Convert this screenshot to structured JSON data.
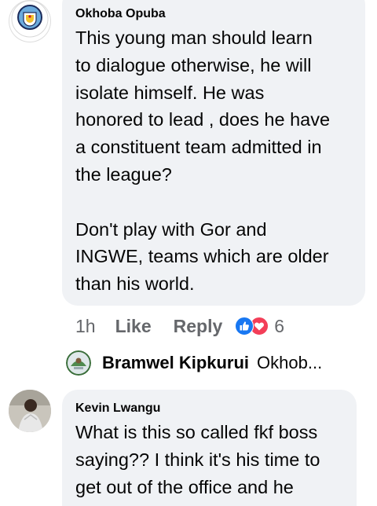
{
  "comments": [
    {
      "author": "Okhoba Opuba",
      "text": "This young man should learn\nto dialogue otherwise, he will\nisolate himself. He was\nhonored to lead , does he have\na constituent team admitted in\nthe league?\n\nDon't play with Gor and\nINGWE, teams which are older\nthan his world.",
      "time": "1h",
      "like_label": "Like",
      "reply_label": "Reply",
      "reaction_count": "6",
      "reaction_icons": [
        "like-icon",
        "love-icon"
      ],
      "reply_preview": {
        "author": "Bramwel Kipkurui",
        "snippet": "Okhob..."
      }
    },
    {
      "author": "Kevin Lwangu",
      "text": "What is this so called fkf boss\nsaying?? I think it's his time to\nget out of the office and he"
    }
  ],
  "colors": {
    "bubble": "#f0f2f5",
    "meta_text": "#65676b",
    "like_blue": "#1877f2",
    "love_red": "#f33e58"
  }
}
